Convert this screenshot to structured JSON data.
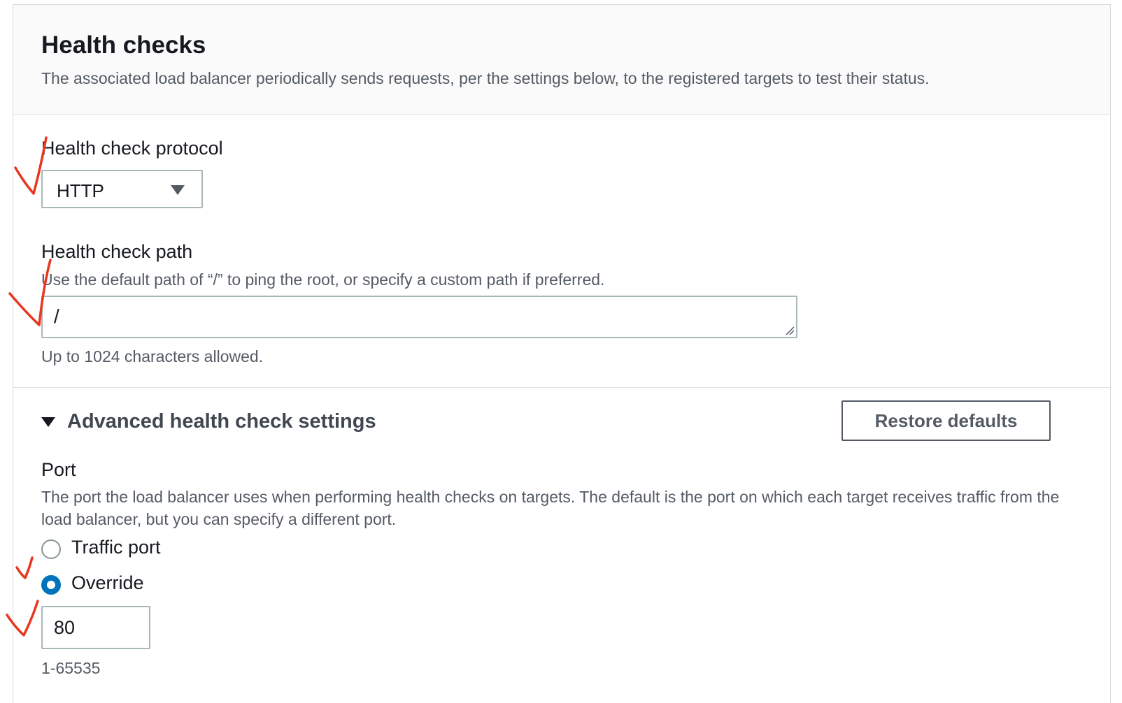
{
  "header": {
    "title": "Health checks",
    "description": "The associated load balancer periodically sends requests, per the settings below, to the registered targets to test their status."
  },
  "protocol": {
    "label": "Health check protocol",
    "selected": "HTTP"
  },
  "path": {
    "label": "Health check path",
    "description": "Use the default path of “/” to ping the root, or specify a custom path if preferred.",
    "value": "/",
    "constraint": "Up to 1024 characters allowed."
  },
  "advanced": {
    "label": "Advanced health check settings",
    "expanded": true,
    "restore_label": "Restore defaults"
  },
  "port": {
    "label": "Port",
    "description": "The port the load balancer uses when performing health checks on targets. The default is the port on which each target receives traffic from the load balancer, but you can specify a different port.",
    "options": [
      {
        "label": "Traffic port",
        "selected": false
      },
      {
        "label": "Override",
        "selected": true
      }
    ],
    "value": "80",
    "constraint": "1-65535"
  },
  "colors": {
    "accent": "#0073bb",
    "annotation": "#e8371f",
    "header_bg": "#fafafa"
  }
}
